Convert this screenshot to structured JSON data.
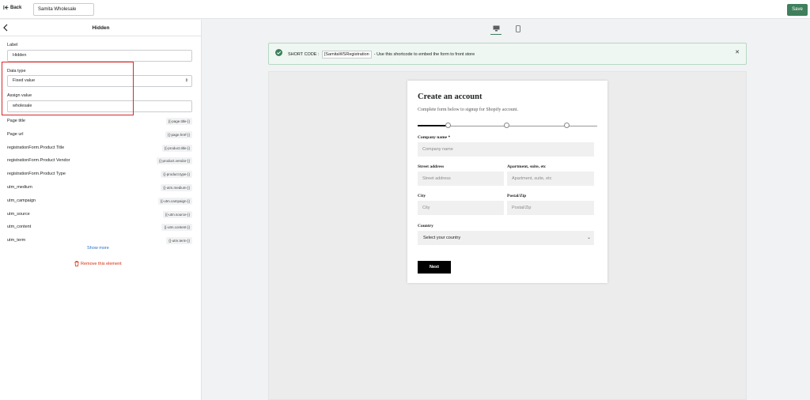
{
  "topbar": {
    "back_label": "Back",
    "form_name": "Samita Wholesale",
    "save_label": "Save"
  },
  "panel": {
    "title": "Hidden",
    "label_field": {
      "label": "Label",
      "value": "Hidden"
    },
    "data_type": {
      "label": "Data type",
      "value": "Fixed value"
    },
    "assign_value": {
      "label": "Assign value",
      "value": "wholesale"
    },
    "variables": [
      {
        "name": "Page title",
        "token": "{{-page.title-}}"
      },
      {
        "name": "Page url",
        "token": "{{-page.href-}}"
      },
      {
        "name": "registrationForm.Product Title",
        "token": "{{-product.title-}}"
      },
      {
        "name": "registrationForm.Product Vendor",
        "token": "{{-product.vendor-}}"
      },
      {
        "name": "registrationForm.Product Type",
        "token": "{{-product.type-}}"
      },
      {
        "name": "utm_medium",
        "token": "{{-utm.medium-}}"
      },
      {
        "name": "utm_campaign",
        "token": "{{-utm.campaign-}}"
      },
      {
        "name": "utm_source",
        "token": "{{-utm.source-}}"
      },
      {
        "name": "utm_content",
        "token": "{{-utm.content-}}"
      },
      {
        "name": "utm_term",
        "token": "{{-utm.term-}}"
      }
    ],
    "show_more": "Show more",
    "remove": "Remove this element"
  },
  "notice": {
    "prefix": "SHORT CODE :",
    "code": "{SamitaWSRegistration",
    "suffix": "- Use this shortcode to embed the form to front store"
  },
  "form": {
    "title": "Create an account",
    "subtitle": "Complete form below to signup for Shopify account.",
    "company": {
      "label": "Company name *",
      "placeholder": "Company name"
    },
    "street": {
      "label": "Street address",
      "placeholder": "Street address"
    },
    "apt": {
      "label": "Apartment, suite, etc",
      "placeholder": "Apartment, suite, etc"
    },
    "city": {
      "label": "City",
      "placeholder": "City"
    },
    "postal": {
      "label": "Postal/Zip",
      "placeholder": "Postal/Zip"
    },
    "country": {
      "label": "Country",
      "value": "Select your country"
    },
    "next": "Next"
  },
  "icons": {
    "back": "back-arrow-icon",
    "desktop": "desktop-icon",
    "mobile": "mobile-icon",
    "check": "check-circle-icon",
    "close": "close-icon",
    "trash": "trash-icon"
  },
  "colors": {
    "accent": "#3f7f5c",
    "highlight": "#d62828",
    "link": "#2c6ecb",
    "danger": "#d72c0d"
  }
}
